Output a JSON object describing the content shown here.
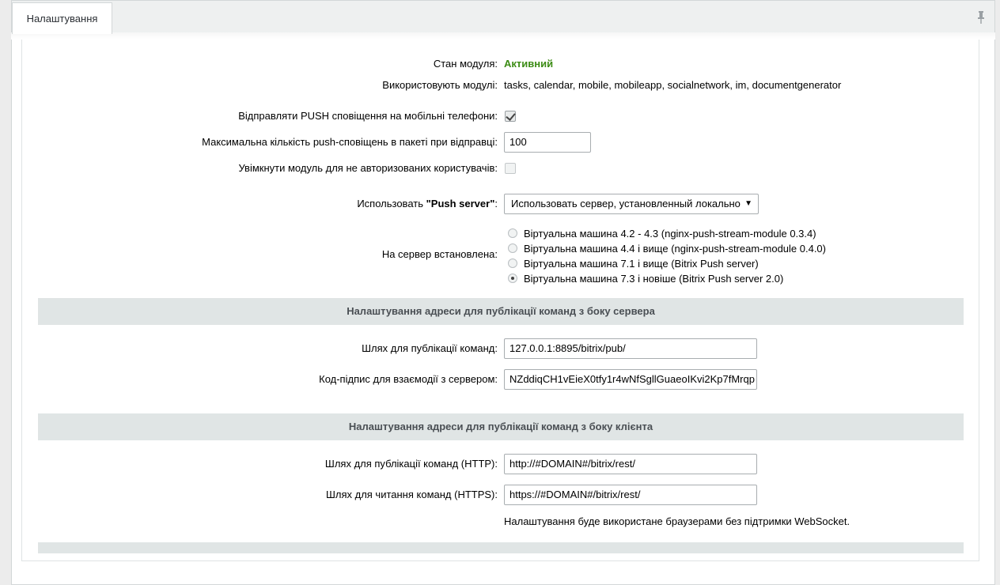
{
  "tabs": {
    "active": "Налаштування"
  },
  "status": {
    "label": "Стан модуля:",
    "value": "Активний",
    "color": "#3c8c15"
  },
  "used_by": {
    "label": "Використовують модулі:",
    "value": "tasks, calendar, mobile, mobileapp, socialnetwork, im, documentgenerator"
  },
  "push_mobile": {
    "label": "Відправляти PUSH сповіщення на мобільні телефони:",
    "checked": true
  },
  "max_push": {
    "label": "Максимальна кількість push-сповіщень в пакеті при відправці:",
    "value": "100"
  },
  "guest_enable": {
    "label": "Увімкнути модуль для не авторизованих користувачів:",
    "checked": false
  },
  "push_server": {
    "label_prefix": "Использовать ",
    "label_bold": "\"Push server\"",
    "label_suffix": ":",
    "selected": "Использовать сервер, установленный локально"
  },
  "installed": {
    "label": "На сервер встановлена:",
    "options": [
      {
        "text": "Віртуальна машина 4.2 - 4.3 (nginx-push-stream-module 0.3.4)",
        "selected": false
      },
      {
        "text": "Віртуальна машина 4.4 і вище (nginx-push-stream-module 0.4.0)",
        "selected": false
      },
      {
        "text": "Віртуальна машина 7.1 і вище (Bitrix Push server)",
        "selected": false
      },
      {
        "text": "Віртуальна машина 7.3 і новіше (Bitrix Push server 2.0)",
        "selected": true
      }
    ]
  },
  "server_section": {
    "title": "Налаштування адреси для публікації команд з боку сервера",
    "pub_path_label": "Шлях для публікації команд:",
    "pub_path_value": "127.0.0.1:8895/bitrix/pub/",
    "sign_label": "Код-підпис для взаємодії з сервером:",
    "sign_value": "NZddiqCH1vEieX0tfy1r4wNfSgllGuaeoIKvi2Kp7fMrqp"
  },
  "client_section": {
    "title": "Налаштування адреси для публікації команд з боку клієнта",
    "http_label": "Шлях для публікації команд (HTTP):",
    "http_value": "http://#DOMAIN#/bitrix/rest/",
    "https_label": "Шлях для читання команд (HTTPS):",
    "https_value": "https://#DOMAIN#/bitrix/rest/",
    "note": "Налаштування буде використане браузерами без підтримки WebSocket."
  }
}
